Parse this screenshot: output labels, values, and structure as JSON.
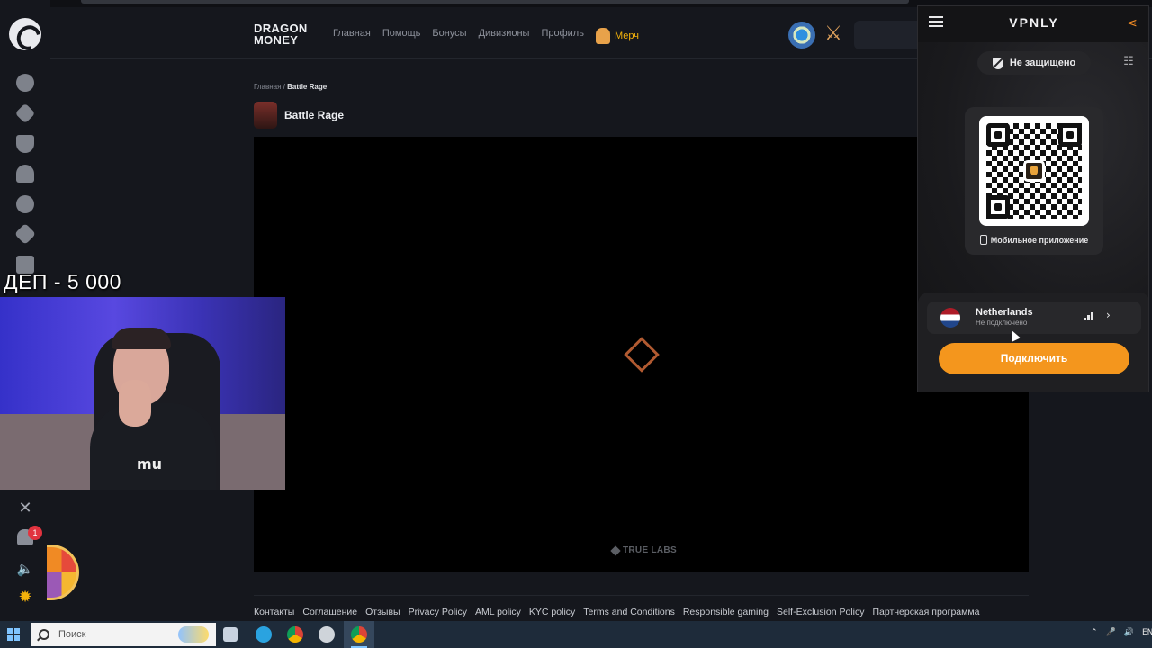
{
  "site": {
    "brand_line1": "DRAGON",
    "brand_line2": "MONEY",
    "nav": [
      "Главная",
      "Помощь",
      "Бонусы",
      "Дивизионы",
      "Профиль"
    ],
    "merch_label": "Мерч",
    "notifications_count": "1"
  },
  "breadcrumb": {
    "home": "Главная",
    "separator": "/",
    "current": "Battle Rage"
  },
  "game": {
    "title": "Battle Rage",
    "provider": "TRUE LABS"
  },
  "footer": {
    "links": [
      "Контакты",
      "Соглашение",
      "Отзывы",
      "Privacy Policy",
      "AML policy",
      "KYC policy",
      "Terms and Conditions",
      "Responsible gaming",
      "Self-Exclusion Policy",
      "Партнерская программа"
    ]
  },
  "overlay": {
    "deposit_label": "ДЕП -  5 000"
  },
  "vpn": {
    "title": "VPNLY",
    "status": "Не защищено",
    "qr_caption": "Мобильное приложение",
    "country": "Netherlands",
    "country_status": "Не подключено",
    "connect_label": "Подключить",
    "accent": "#f4961d"
  },
  "taskbar": {
    "search_placeholder": "Поиск",
    "lang": "ENG"
  },
  "icons": {
    "sidebar": [
      "smile-icon",
      "lightning-icon",
      "trophy-icon",
      "person-icon",
      "bomb-icon",
      "rocket-icon",
      "dice-icon"
    ]
  }
}
